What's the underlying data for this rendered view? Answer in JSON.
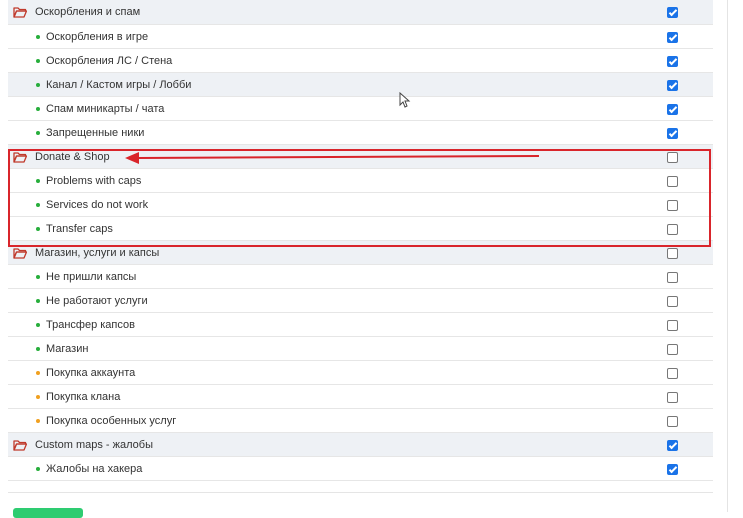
{
  "rows": [
    {
      "type": "category",
      "label": "Оскорбления и спам",
      "checked": true
    },
    {
      "type": "item",
      "dot": "green",
      "label": "Оскорбления в игре",
      "checked": true
    },
    {
      "type": "item",
      "dot": "green",
      "label": "Оскорбления ЛС / Стена",
      "checked": true
    },
    {
      "type": "category",
      "label": "Канал / Кастом игры / Лобби",
      "dot": "green",
      "checked": true
    },
    {
      "type": "item",
      "dot": "green",
      "label": "Спам миникарты / чата",
      "checked": true
    },
    {
      "type": "item",
      "dot": "green",
      "label": "Запрещенные ники",
      "checked": true
    },
    {
      "type": "category",
      "label": "Donate & Shop",
      "checked": false
    },
    {
      "type": "item",
      "dot": "green",
      "label": "Problems with caps",
      "checked": false
    },
    {
      "type": "item",
      "dot": "green",
      "label": "Services do not work",
      "checked": false
    },
    {
      "type": "item",
      "dot": "green",
      "label": "Transfer caps",
      "checked": false
    },
    {
      "type": "category",
      "label": "Магазин, услуги и капсы",
      "checked": false
    },
    {
      "type": "item",
      "dot": "green",
      "label": "Не пришли капсы",
      "checked": false
    },
    {
      "type": "item",
      "dot": "green",
      "label": "Не работают услуги",
      "checked": false
    },
    {
      "type": "item",
      "dot": "green",
      "label": "Трансфер капсов",
      "checked": false
    },
    {
      "type": "item",
      "dot": "green",
      "label": "Магазин",
      "checked": false
    },
    {
      "type": "item",
      "dot": "orange",
      "label": "Покупка аккаунта",
      "checked": false
    },
    {
      "type": "item",
      "dot": "orange",
      "label": "Покупка клана",
      "checked": false
    },
    {
      "type": "item",
      "dot": "orange",
      "label": "Покупка особенных услуг",
      "checked": false
    },
    {
      "type": "category",
      "label": "Custom maps - жалобы",
      "checked": true
    },
    {
      "type": "item",
      "dot": "green",
      "label": "Жалобы на хакера",
      "checked": true
    }
  ],
  "colors": {
    "folder": "#c0392b",
    "dot_green": "#27ae3c",
    "dot_orange": "#f0a020",
    "checkbox_on": "#1a73e8",
    "annotation": "#d9252b"
  },
  "icons": {
    "folder": "folder-open-icon",
    "cursor": "mouse-cursor-icon",
    "annotation_arrow": "arrow-left-icon"
  }
}
